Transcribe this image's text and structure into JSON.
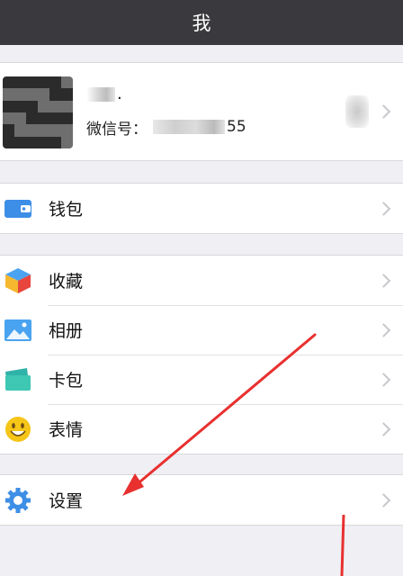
{
  "navbar": {
    "title": "我"
  },
  "profile": {
    "name_suffix": ".",
    "wechat_id_label": "微信号：",
    "wechat_id_suffix": "55"
  },
  "menu": {
    "wallet": {
      "label": "钱包",
      "icon": "wallet-icon"
    },
    "favorites": {
      "label": "收藏",
      "icon": "cube-icon"
    },
    "album": {
      "label": "相册",
      "icon": "picture-icon"
    },
    "cards": {
      "label": "卡包",
      "icon": "card-pack-icon"
    },
    "stickers": {
      "label": "表情",
      "icon": "smiley-icon"
    },
    "settings": {
      "label": "设置",
      "icon": "gear-icon"
    }
  },
  "colors": {
    "navbar_bg": "#3a3a3e",
    "page_bg": "#efeff4",
    "annotation_arrow": "#e8302f",
    "icon_blue": "#3d8ee6",
    "icon_yellow": "#f5c518"
  }
}
